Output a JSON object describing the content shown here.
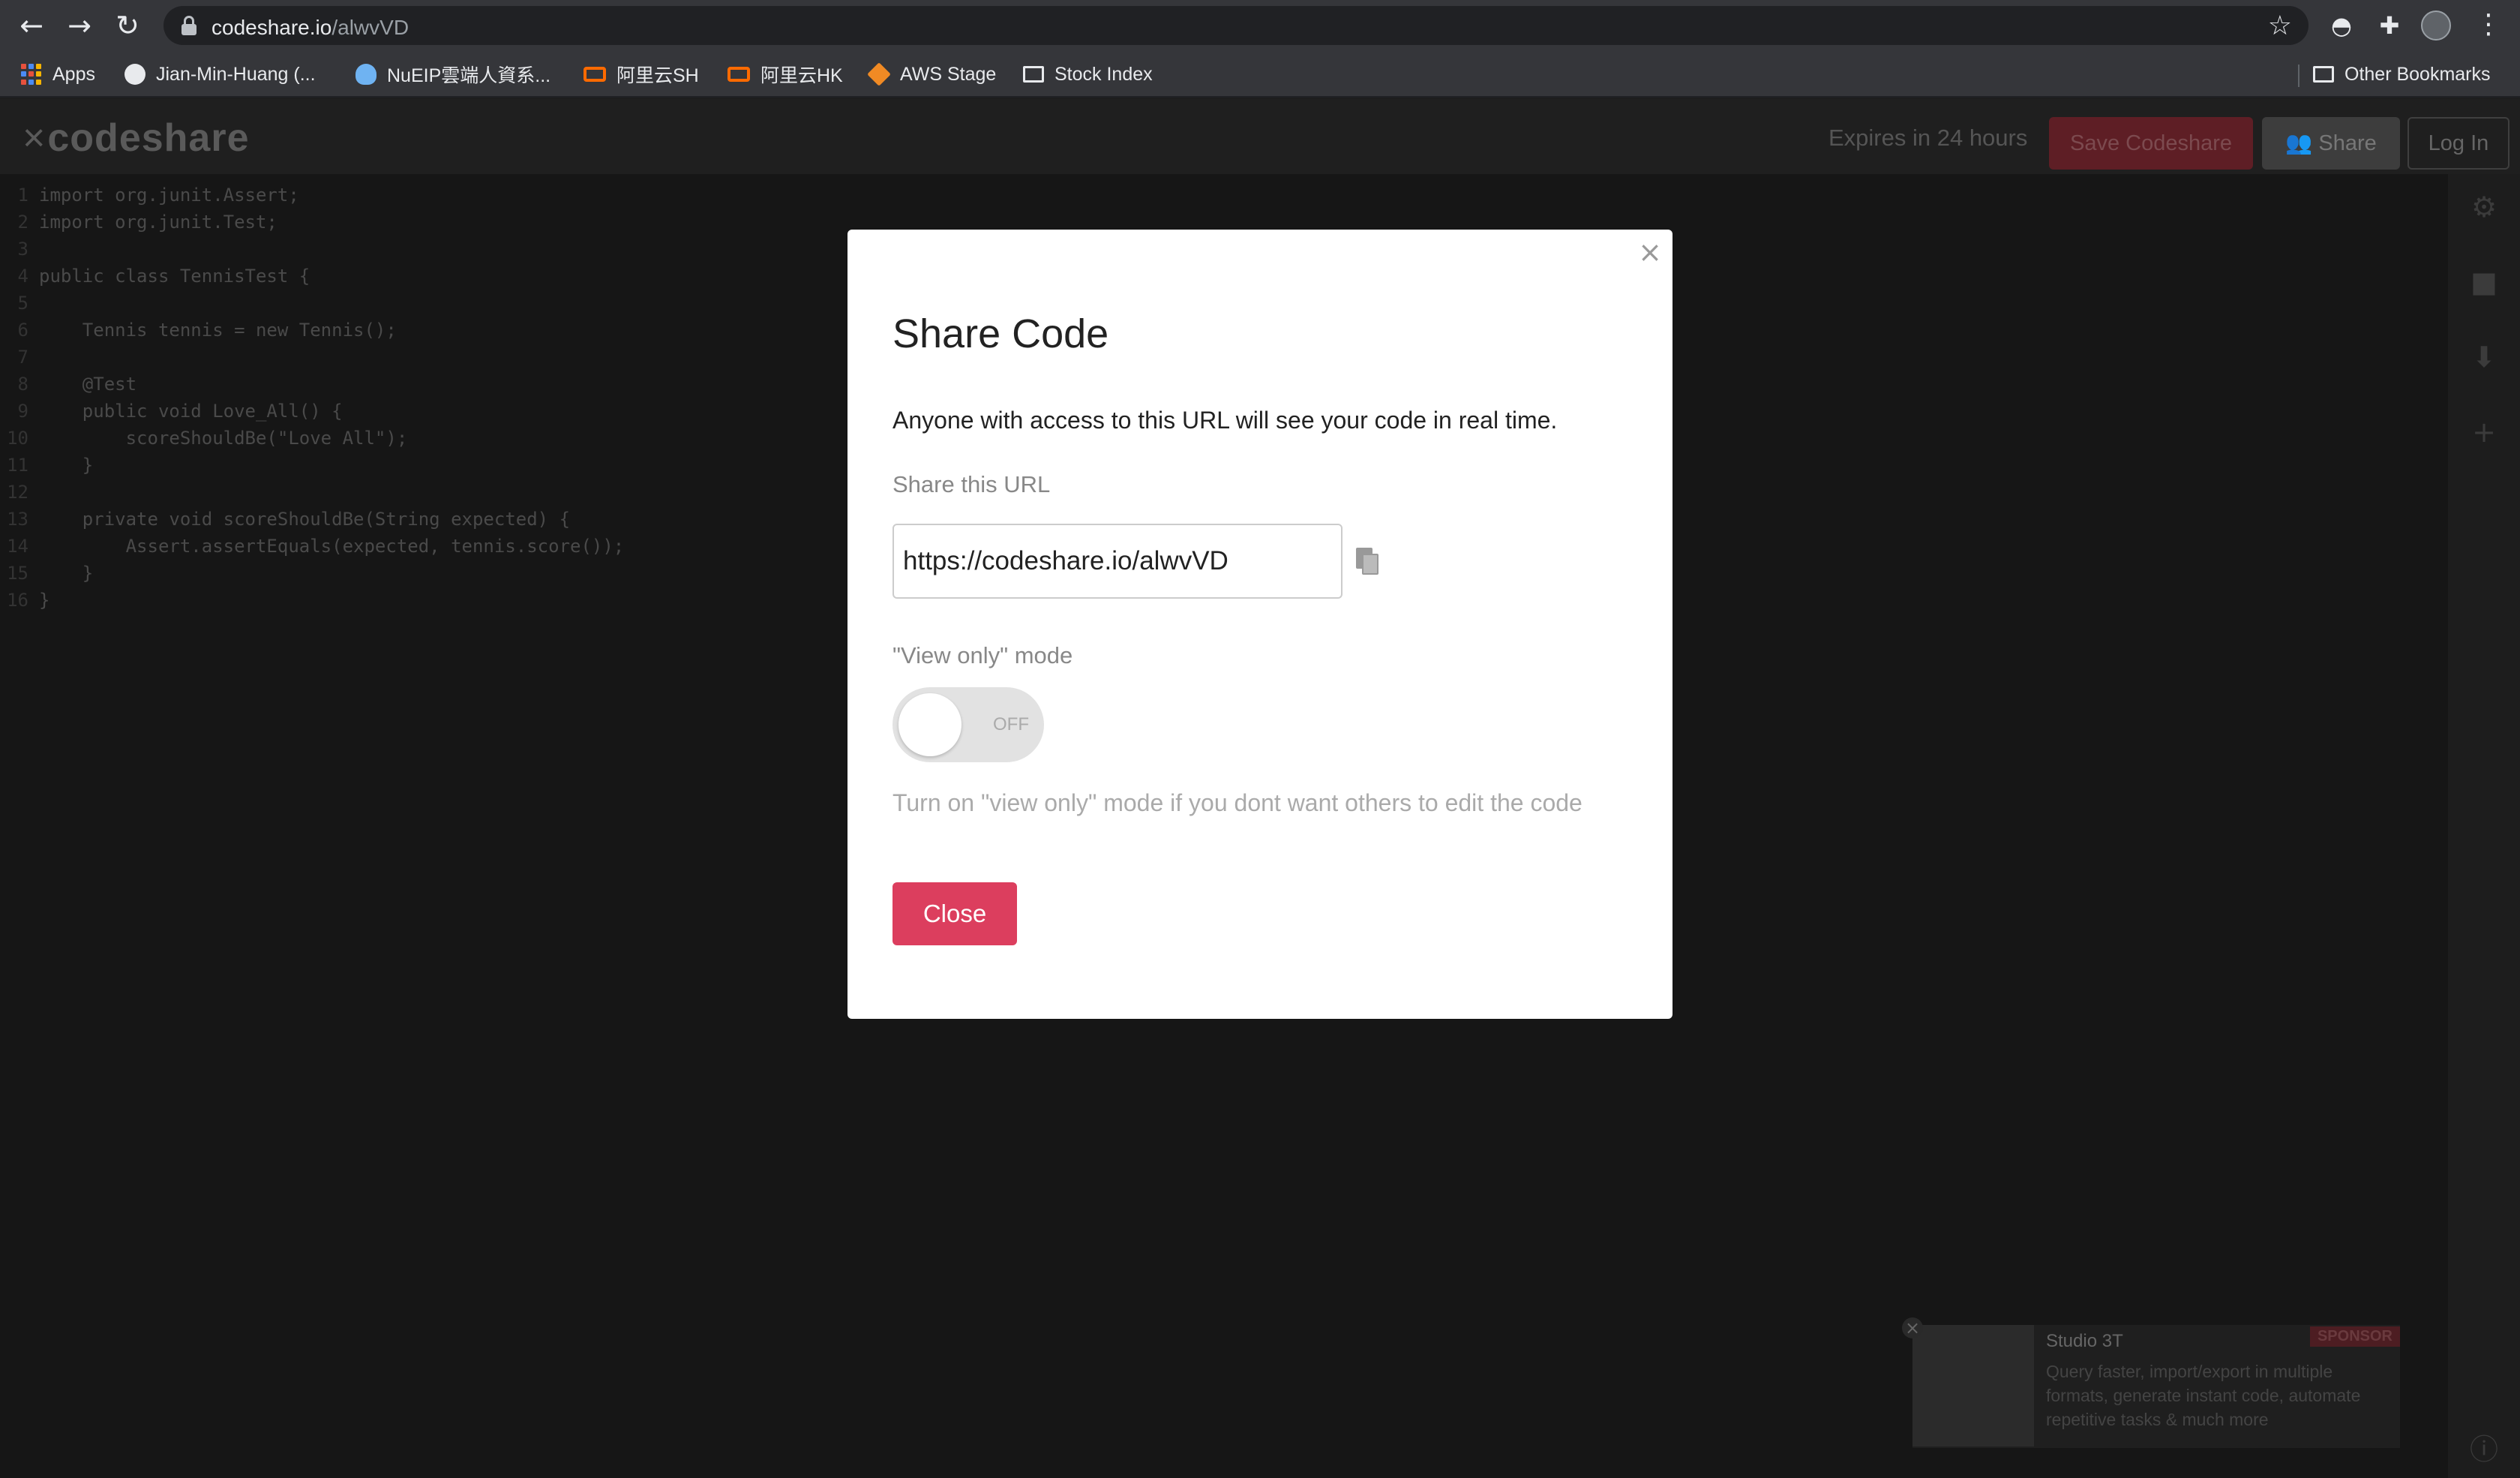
{
  "browser": {
    "url_host": "codeshare.io",
    "url_path": "/alwvVD",
    "bookmarks": [
      {
        "label": "Apps",
        "icon": "apps-grid-icon"
      },
      {
        "label": "Jian-Min-Huang (...",
        "icon": "github-icon"
      },
      {
        "label": "NuEIP雲端人資系...",
        "icon": "cloud-icon"
      },
      {
        "label": "阿里云SH",
        "icon": "alibaba-cloud-icon"
      },
      {
        "label": "阿里云HK",
        "icon": "alibaba-cloud-icon"
      },
      {
        "label": "AWS Stage",
        "icon": "aws-icon"
      },
      {
        "label": "Stock Index",
        "icon": "folder-icon"
      }
    ],
    "other_bookmarks": "Other Bookmarks"
  },
  "app": {
    "logo": "codeshare",
    "expires": "Expires in 24 hours",
    "save_label": "Save Codeshare",
    "share_label": "Share",
    "login_label": "Log In"
  },
  "code": {
    "lines": [
      "import org.junit.Assert;",
      "import org.junit.Test;",
      "",
      "public class TennisTest {",
      "",
      "    Tennis tennis = new Tennis();",
      "",
      "    @Test",
      "    public void Love_All() {",
      "        scoreShouldBe(\"Love All\");",
      "    }",
      "",
      "    private void scoreShouldBe(String expected) {",
      "        Assert.assertEquals(expected, tennis.score());",
      "    }",
      "}"
    ]
  },
  "modal": {
    "close_symbol": "×",
    "title": "Share Code",
    "description": "Anyone with access to this URL will see your code in real time.",
    "url_label": "Share this URL",
    "url_value": "https://codeshare.io/alwvVD",
    "view_only_label": "\"View only\" mode",
    "toggle_state": "OFF",
    "help_text": "Turn on \"view only\" mode if you dont want others to edit the code",
    "close_button": "Close"
  },
  "ad": {
    "title": "Studio 3T",
    "badge": "SPONSOR",
    "text": "Query faster, import/export in multiple formats, generate instant code, automate repetitive tasks & much more",
    "close_symbol": "×"
  },
  "colors": {
    "primary_button": "#dc3e5e",
    "modal_bg": "#ffffff",
    "overlay_bg": "#1b1b1b"
  }
}
